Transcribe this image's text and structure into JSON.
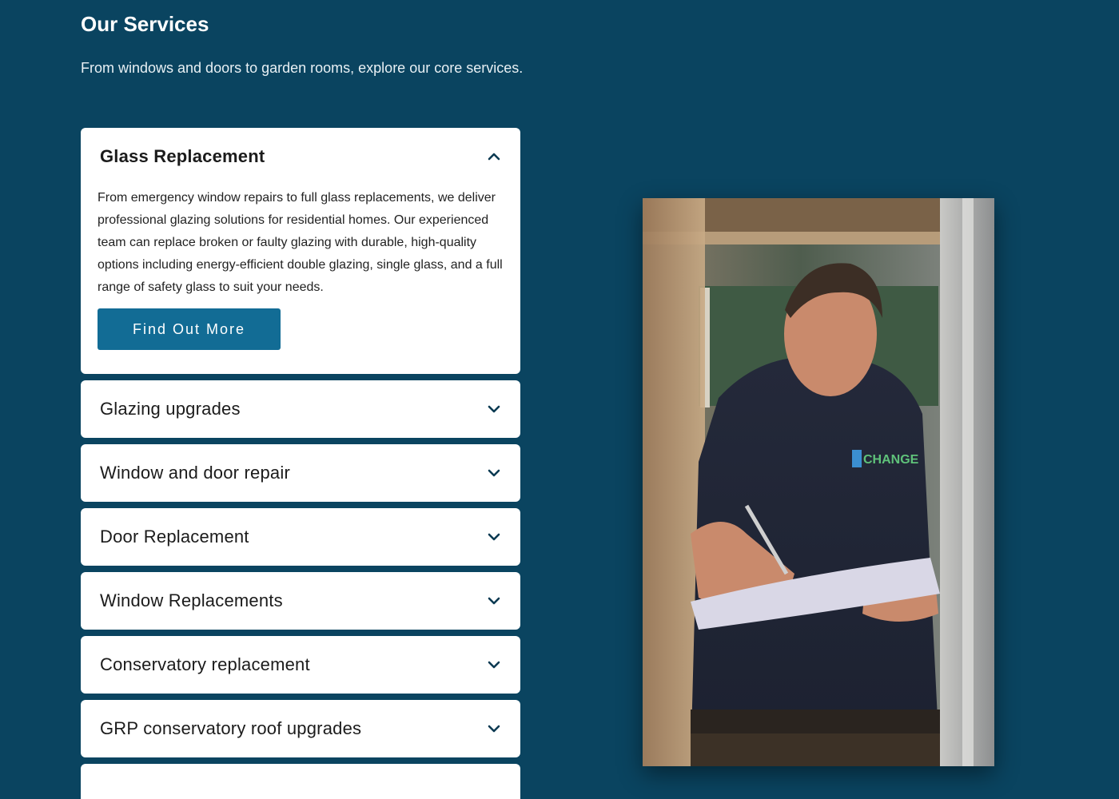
{
  "section": {
    "title": "Our Services",
    "subtitle": "From windows and doors to garden rooms, explore our core services."
  },
  "accordion": {
    "items": [
      {
        "title": "Glass Replacement",
        "open": true,
        "icon": "chevron-up-icon",
        "body": "From emergency window repairs to full glass replacements, we deliver professional glazing solutions for residential homes. Our experienced team can replace broken or faulty glazing with durable, high-quality options including energy-efficient double glazing, single glass, and a full range of safety glass to suit your needs.",
        "button_label": "Find Out More"
      },
      {
        "title": "Glazing upgrades",
        "open": false,
        "icon": "chevron-down-icon"
      },
      {
        "title": "Window and door repair",
        "open": false,
        "icon": "chevron-down-icon"
      },
      {
        "title": "Door Replacement",
        "open": false,
        "icon": "chevron-down-icon"
      },
      {
        "title": "Window Replacements",
        "open": false,
        "icon": "chevron-down-icon"
      },
      {
        "title": "Conservatory replacement",
        "open": false,
        "icon": "chevron-down-icon"
      },
      {
        "title": "GRP conservatory roof upgrades",
        "open": false,
        "icon": "chevron-down-icon"
      },
      {
        "title": "",
        "open": false,
        "icon": "chevron-down-icon"
      }
    ]
  },
  "photo": {
    "description_icon": "worker-photo",
    "shirt_logo": "CHANGE"
  },
  "colors": {
    "background": "#0a4460",
    "card": "#ffffff",
    "button": "#126c95",
    "text": "#1b1b1b"
  }
}
